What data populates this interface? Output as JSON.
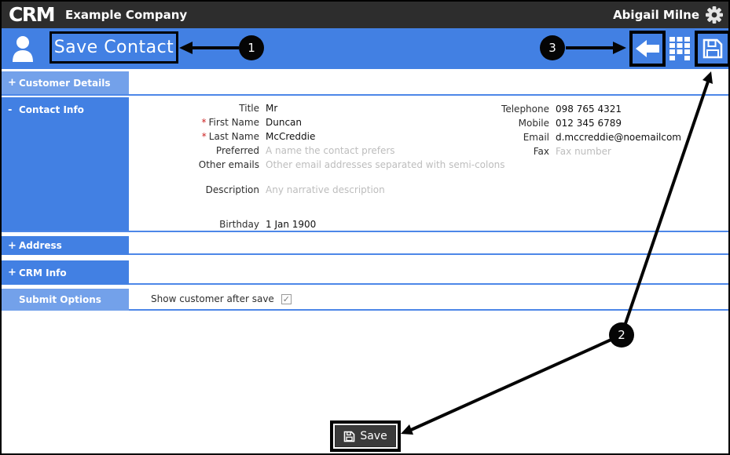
{
  "header": {
    "logo": "CRM",
    "company": "Example Company",
    "user": "Abigail Milne"
  },
  "toolbar": {
    "title": "Save Contact"
  },
  "sidebar": {
    "items": [
      {
        "prefix": "+",
        "label": "Customer Details"
      },
      {
        "prefix": "-",
        "label": "Contact Info"
      },
      {
        "prefix": "+",
        "label": "Address"
      },
      {
        "prefix": "+",
        "label": "CRM Info"
      },
      {
        "prefix": "",
        "label": "Submit Options"
      }
    ]
  },
  "form": {
    "required_marker": "*",
    "fields_left": [
      {
        "label": "Title",
        "value": "Mr"
      },
      {
        "label": "First Name",
        "value": "Duncan",
        "required": true
      },
      {
        "label": "Last Name",
        "value": "McCreddie",
        "required": true
      },
      {
        "label": "Preferred",
        "placeholder": "A name the contact prefers"
      },
      {
        "label": "Other emails",
        "placeholder": "Other email addresses separated with semi-colons"
      },
      {
        "label": "Description",
        "placeholder": "Any narrative description"
      },
      {
        "label": "Birthday",
        "value": "1 Jan 1900"
      }
    ],
    "fields_right": [
      {
        "label": "Telephone",
        "value": "098 765 4321"
      },
      {
        "label": "Mobile",
        "value": "012 345 6789"
      },
      {
        "label": "Email",
        "value": "d.mccreddie@noemailcom"
      },
      {
        "label": "Fax",
        "placeholder": "Fax number"
      }
    ],
    "submit_options": {
      "label": "Show customer after save",
      "checked": true,
      "check_glyph": "✓"
    }
  },
  "footer": {
    "save_label": "Save"
  },
  "annotations": {
    "step1": "1",
    "step2": "2",
    "step3": "3"
  },
  "colors": {
    "accent_blue": "#4280e3",
    "light_blue": "#73a1ea",
    "separator_blue": "#4d87e8",
    "topbar_gray": "#2d2d2d",
    "required_red": "#cc2222",
    "annotation_black": "#000000"
  }
}
